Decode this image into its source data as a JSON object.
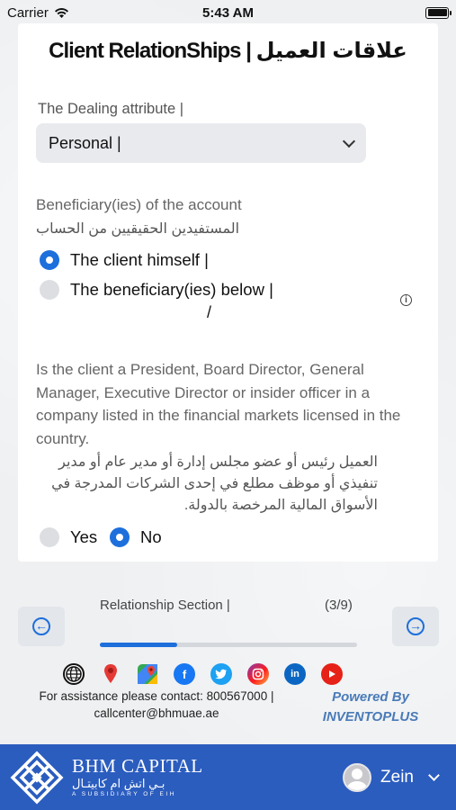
{
  "status_bar": {
    "carrier": "Carrier",
    "time": "5:43 AM"
  },
  "page": {
    "title": "Client RelationShips | علاقات العميل"
  },
  "dealing": {
    "label": "The Dealing attribute |",
    "selected": "Personal |"
  },
  "beneficiary": {
    "label_en": "Beneficiary(ies) of the account",
    "label_ar": "المستفيدين الحقيقيين من الحساب",
    "options": [
      {
        "label": "The client himself |",
        "selected": true
      },
      {
        "label": "The beneficiary(ies) below |",
        "selected": false
      }
    ],
    "extra_slash": "/",
    "info_icon": "info-icon"
  },
  "insider": {
    "question_en": "Is the client a President, Board Director, General Manager, Executive Director or insider officer in a company listed in the financial markets licensed in the country.",
    "question_ar": "العميل رئيس أو عضو مجلس إدارة أو مدير عام أو مدير تنفيذي أو موظف مطلع في إحدى الشركات المدرجة في الأسواق المالية المرخصة بالدولة.",
    "options": [
      {
        "label": "Yes",
        "selected": false
      },
      {
        "label": "No",
        "selected": true
      }
    ]
  },
  "progress": {
    "section_label": "Relationship Section |",
    "count": "(3/9)",
    "value": 0.3
  },
  "social": [
    "globe-icon",
    "map-pin-icon",
    "maps-icon",
    "facebook-icon",
    "twitter-icon",
    "instagram-icon",
    "linkedin-icon",
    "youtube-icon"
  ],
  "contact": {
    "line1": "For assistance please contact: 800567000 |",
    "line2": "callcenter@bhmuae.ae"
  },
  "powered": {
    "line1": "Powered By",
    "line2": "INVENTOPLUS"
  },
  "footer": {
    "brand_name": "BHM CAPITAL",
    "brand_ar": "بـي اتش ام كابيتـال",
    "brand_sub": "A SUBSIDIARY OF EIH",
    "user_name": "Zein"
  },
  "colors": {
    "accent": "#1d6fdc",
    "footer": "#2b5dbf",
    "powered": "#4a7bb8"
  }
}
